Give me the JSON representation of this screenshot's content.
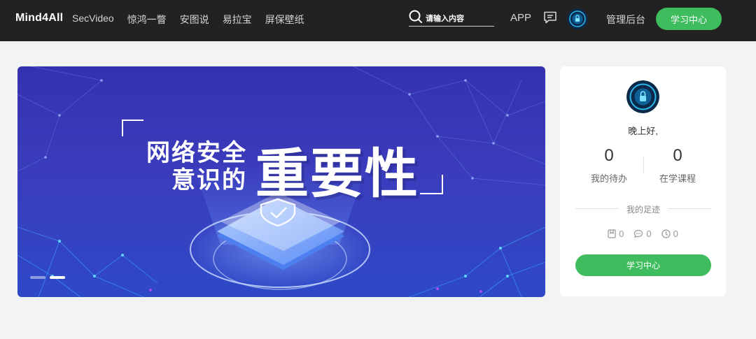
{
  "header": {
    "brand": "Mind4All",
    "nav": [
      "SecVideo",
      "惊鸿一瞥",
      "安图说",
      "易拉宝",
      "屏保壁纸"
    ],
    "search_placeholder": "请输入内容",
    "app_label": "APP",
    "admin_label": "管理后台",
    "learn_button": "学习中心"
  },
  "banner": {
    "line1": "网络安全",
    "line2": "意识的",
    "highlight": "重要性",
    "slide_count": 2,
    "active_slide": 2
  },
  "user_card": {
    "greeting": "晚上好,",
    "todo_count": "0",
    "todo_label": "我的待办",
    "courses_count": "0",
    "courses_label": "在学课程",
    "trail_title": "我的足迹",
    "bookmarks": "0",
    "comments": "0",
    "history": "0",
    "learn_button": "学习中心"
  },
  "colors": {
    "topbar": "#222222",
    "accent_green": "#3fbd5e",
    "page_background": "#f2f3f5",
    "banner_blue": "#3532b0"
  },
  "icons": [
    "search-icon",
    "message-icon",
    "avatar",
    "bookmark-icon",
    "comment-icon",
    "clock-icon"
  ]
}
